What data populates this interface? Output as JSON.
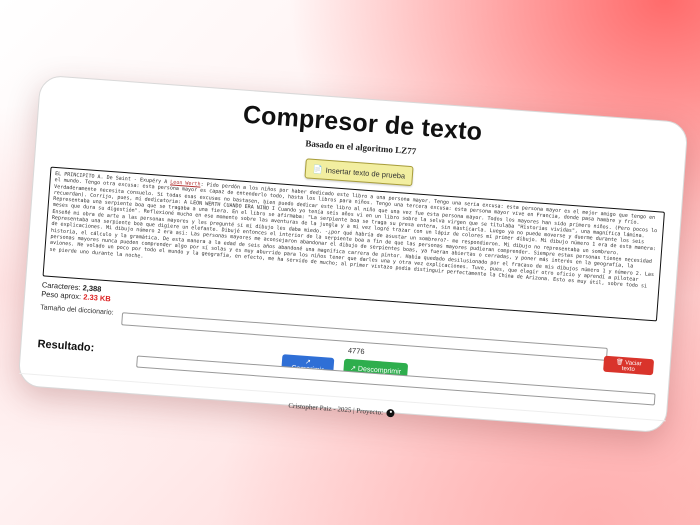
{
  "app": {
    "title": "Compresor de texto",
    "subtitle": "Basado en el algoritmo LZ77"
  },
  "toolbar": {
    "insert_sample_label": "Insertar texto de prueba",
    "insert_icon": "document-icon"
  },
  "text_input": {
    "value_prefix": "EL PRINCIPITO A. De Saint - Exupéry A ",
    "link_text": "Leon Werth",
    "value_rest": ": Pido perdón a los niños por haber dedicado este libro a una persona mayor. Tengo una seria excusa: esta persona mayor es el mejor amigo que tengo en el mundo. Tengo otra excusa: esta persona mayor es capaz de entenderlo todo, hasta los libros para niños. Tengo una tercera excusa: esta persona mayor vive en Francia, donde pasa hambre y frío. Verdaderamente necesita consuelo. Si todas esas excusas no bastasen, bien puedo dedicar este libro al niño que una vez fue esta persona mayor. Todos los mayores han sido primero niños. (Pero pocos lo recuerdan). Corrijo, pues, mi dedicatoria: A LEON WERTH CUANDO ERA NIÑO I Cuando yo tenía seis años vi en un libro sobre la selva virgen que se titulaba \"Historias vividas\", una magnífica lámina. Representaba una serpiente boa que se tragaba a una fiera. En el libro se afirmaba: \"La serpiente boa se traga su presa entera, sin masticarla. Luego ya no puede moverse y duerme durante los seis meses que dura su digestión\". Reflexioné mucho en ese momento sobre las aventuras de la jungla y a mi vez logré trazar con un lápiz de colores mi primer dibujo. Mi dibujo número 1 era de esta manera: Enseñé mi obra de arte a las personas mayores y les pregunté si mi dibujo les daba miedo. -¿por qué habría de asustar un sombrero?- me respondieron. Mi dibujo no representaba un sombrero. Representaba una serpiente boa que digiere un elefante. Dibujé entonces el interior de la serpiente boa a fin de que las personas mayores pudieran comprender. Siempre estas personas tienen necesidad de explicaciones. Mi dibujo número 2 era así: Las personas mayores me aconsejaron abandonar el dibujo de serpientes boas, ya fueran abiertas o cerradas, y poner más interés en la geografía, la historia, el cálculo y la gramática. De esta manera a la edad de seis años abandoné una magnífica carrera de pintor. Había quedado desilusionado por el fracaso de mis dibujos número 1 y número 2. Las personas mayores nunca pueden comprender algo por sí solas y es muy aburrido para los niños tener que darles una y otra vez explicaciones. Tuve, pues, que elegir otro oficio y aprendí a pilotear aviones. He volado un poco por todo el mundo y la geografía, en efecto, me ha servido de mucho; al primer vistazo podía distinguir perfectamente la China de Arizona. Esto es muy útil, sobre todo si se pierde uno durante la noche."
  },
  "stats": {
    "chars_label": "Caracteres:",
    "chars_value": "2,388",
    "weight_label": "Peso aprox:",
    "weight_value": "2.33 KB"
  },
  "dictionary": {
    "label": "Tamaño del diccionario:",
    "value": "4776"
  },
  "buttons": {
    "clear_label": "Vaciar texto",
    "compress_label": "Comprimir",
    "decompress_label": "Descomprimir"
  },
  "result": {
    "label": "Resultado:"
  },
  "footer": {
    "text": "Cristopher Paiz - 2025 | Proyecto:",
    "icon": "github-icon"
  },
  "colors": {
    "clear": "#d9342b",
    "compress": "#2f6fd6",
    "decompress": "#2eae4d",
    "sample": "#f2eea0",
    "weight_value": "#dd2222"
  }
}
